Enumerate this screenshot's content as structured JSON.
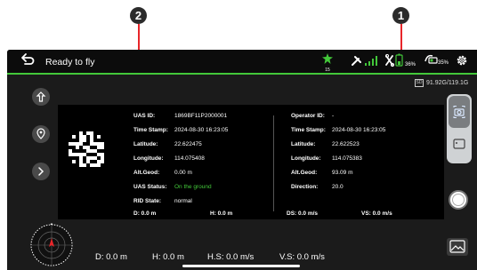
{
  "callouts": {
    "left": "2",
    "right": "1"
  },
  "status": {
    "text": "Ready to fly"
  },
  "topbar": {
    "gps_count": "15",
    "rc_battery": "36%",
    "drone_battery": "35%"
  },
  "storage": {
    "card_label": "SD",
    "value": "91.92G/119.1G"
  },
  "left_panel": [
    {
      "label": "UAS ID:",
      "value": "1869BF11P2000001"
    },
    {
      "label": "Time Stamp:",
      "value": "2024-08-30 16:23:05"
    },
    {
      "label": "Latitude:",
      "value": "22.622475"
    },
    {
      "label": "Longitude:",
      "value": "114.075408"
    },
    {
      "label": "Alt.Geod:",
      "value": "0.00 m"
    },
    {
      "label": "UAS Status:",
      "value": "On the ground"
    },
    {
      "label": "RID State:",
      "value": "normal"
    }
  ],
  "right_panel": [
    {
      "label": "Operator ID:",
      "value": "-"
    },
    {
      "label": "Time Stamp:",
      "value": "2024-08-30 16:23:05"
    },
    {
      "label": "Latitude:",
      "value": "22.622523"
    },
    {
      "label": "Longitude:",
      "value": "114.075383"
    },
    {
      "label": "Alt.Geod:",
      "value": "93.09 m"
    },
    {
      "label": "Direction:",
      "value": "20.0"
    }
  ],
  "panel_footer": {
    "d": "D: 0.0 m",
    "h": "H: 0.0 m",
    "ds": "DS: 0.0 m/s",
    "vs": "VS: 0.0 m/s"
  },
  "telemetry": {
    "d": "D: 0.0 m",
    "h": "H: 0.0 m",
    "hs": "H.S: 0.0 m/s",
    "vs": "V.S: 0.0 m/s"
  },
  "colors": {
    "accent_green": "#43c83a",
    "callout_red": "#e8262a"
  },
  "icons": [
    "back-arrow-icon",
    "gps-satellite-icon",
    "rc-signal-icon",
    "drone-battery-icon",
    "camera-battery-icon",
    "settings-gear-icon",
    "takeoff-icon",
    "map-pin-icon",
    "expand-arrow-icon",
    "photo-mode-icon",
    "video-mode-icon",
    "shutter-button",
    "gallery-icon",
    "radar-compass-icon",
    "qr-code"
  ]
}
